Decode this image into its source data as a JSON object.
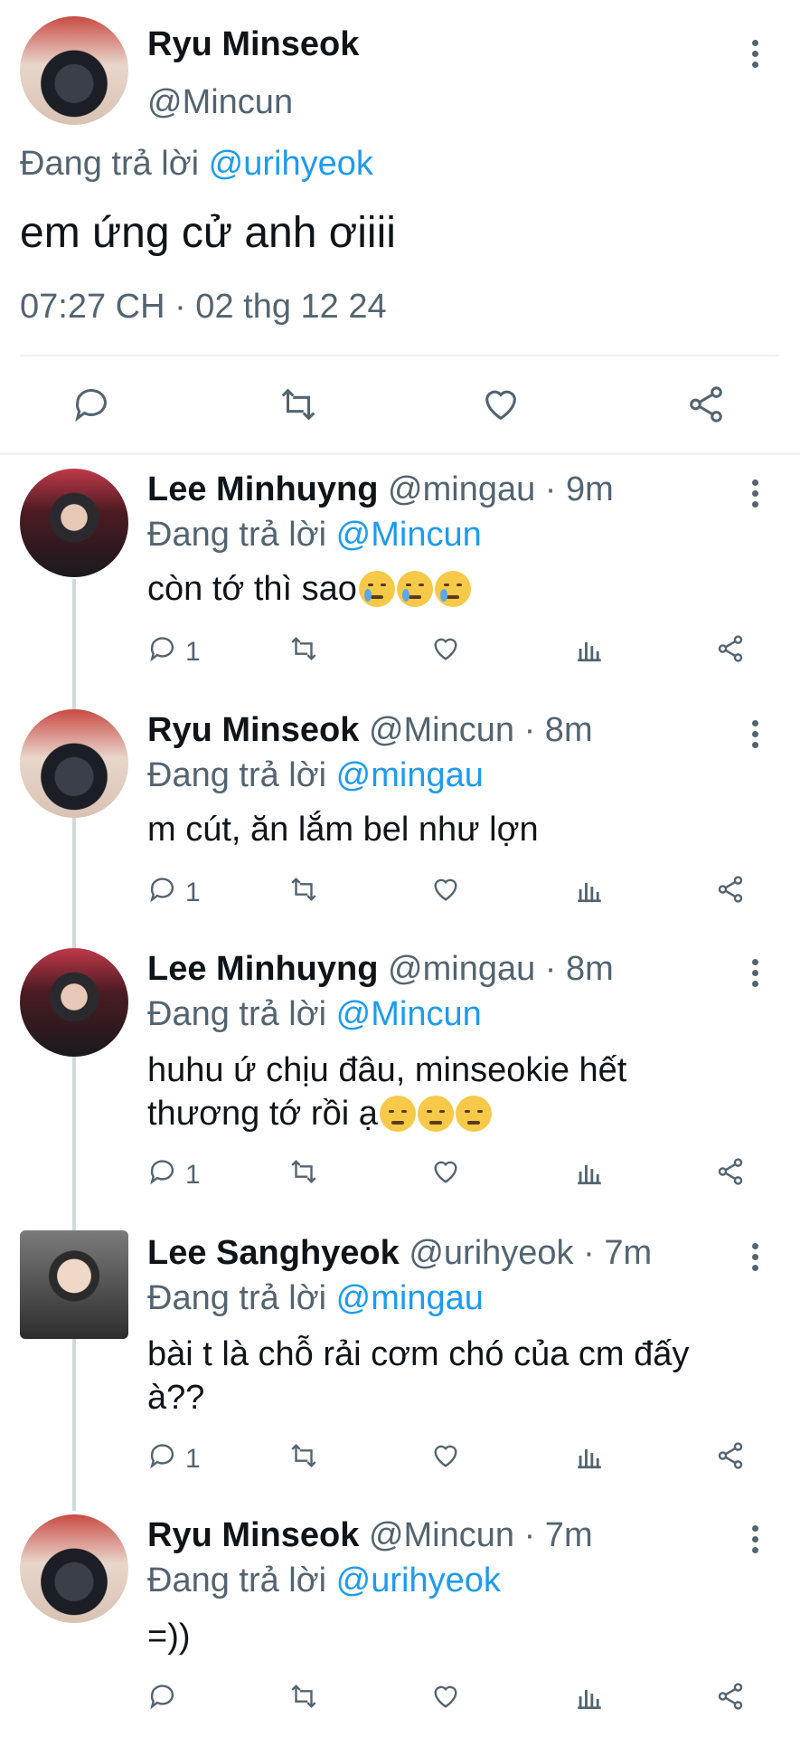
{
  "main_tweet": {
    "name": "Ryu Minseok",
    "handle": "@Mincun",
    "replying_prefix": "Đang trả lời",
    "replying_to": "@urihyeok",
    "text": "em ứng cử anh ơiiii",
    "timestamp": "07:27 CH · 02 thg 12 24"
  },
  "replies": [
    {
      "name": "Lee Minhuyng",
      "handle": "@mingau",
      "time": "· 9m",
      "replying_prefix": "Đang trả lời",
      "replying_to": "@Mincun",
      "line1": "còn tớ thì sao",
      "line2": "",
      "emoji": "crying-face",
      "reply_count": "1"
    },
    {
      "name": "Ryu Minseok",
      "handle": "@Mincun",
      "time": "· 8m",
      "replying_prefix": "Đang trả lời",
      "replying_to": "@mingau",
      "line1": "m cút, ăn lắm bel như lợn",
      "line2": "",
      "reply_count": "1"
    },
    {
      "name": "Lee Minhuyng",
      "handle": "@mingau",
      "time": "· 8m",
      "replying_prefix": "Đang trả lời",
      "replying_to": "@Mincun",
      "line1": "huhu ứ chịu đâu, minseokie hết",
      "line2": "thương tớ rồi ạ",
      "emoji": "pensive-face",
      "reply_count": "1"
    },
    {
      "name": "Lee Sanghyeok",
      "handle": "@urihyeok",
      "time": "· 7m",
      "replying_prefix": "Đang trả lời",
      "replying_to": "@mingau",
      "line1": "bài t là chỗ rải cơm chó của cm đấy",
      "line2": "à??",
      "reply_count": "1"
    },
    {
      "name": "Ryu Minseok",
      "handle": "@Mincun",
      "time": "· 7m",
      "replying_prefix": "Đang trả lời",
      "replying_to": "@urihyeok",
      "line1": "=))",
      "line2": "",
      "reply_count": ""
    }
  ],
  "colors": {
    "link": "#1d9bf0",
    "muted": "#536471",
    "divider": "#eff3f4"
  }
}
